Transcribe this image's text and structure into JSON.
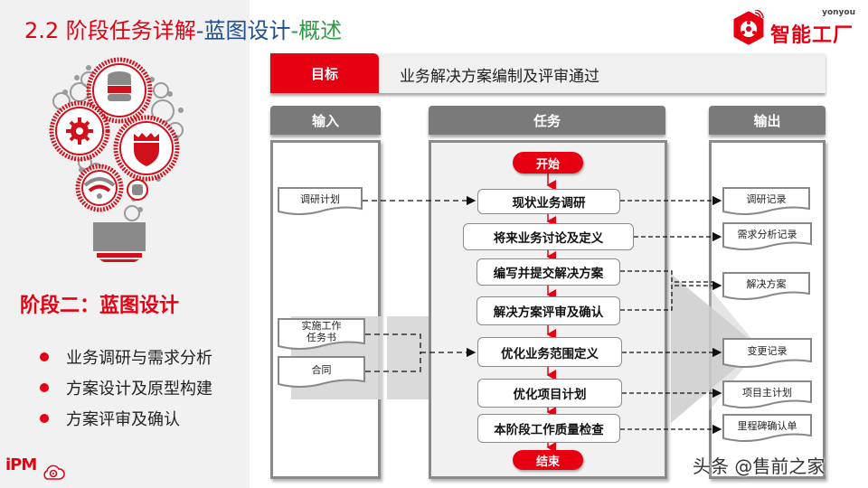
{
  "title": {
    "part1": "2.2 阶段任务详解",
    "sep1": "-",
    "part2": "蓝图设计",
    "sep2": "-",
    "part3": "概述"
  },
  "logo": {
    "brand_small": "yonyou",
    "brand_name": "智能工厂",
    "icon": "hexagon-network-icon"
  },
  "left": {
    "illustration": "lightbulb-gears-icon",
    "stage_title": "阶段二：蓝图设计",
    "bullets": [
      "业务调研与需求分析",
      "方案设计及原型构建",
      "方案评审及确认"
    ],
    "footer_logo": "iPM"
  },
  "goal": {
    "label": "目标",
    "text": "业务解决方案编制及评审通过"
  },
  "columns": {
    "input": "输入",
    "task": "任务",
    "output": "输出"
  },
  "flow": {
    "start": "开始",
    "end": "结束",
    "tasks": [
      "现状业务调研",
      "将来业务讨论及定义",
      "编写并提交解决方案",
      "解决方案评审及确认",
      "优化业务范围定义",
      "优化项目计划",
      "本阶段工作质量检查"
    ],
    "inputs": [
      "调研计划",
      "实施工作\n任务书",
      "合同"
    ],
    "outputs": [
      "调研记录",
      "需求分析记录",
      "解决方案",
      "变更记录",
      "项目主计划",
      "里程碑确认单"
    ]
  },
  "colors": {
    "accent_red": "#e60012",
    "header_gray": "#7a7a7a",
    "title_blue": "#1f4e8c",
    "title_green": "#2e9b47"
  },
  "watermark": "头条 @售前之家"
}
